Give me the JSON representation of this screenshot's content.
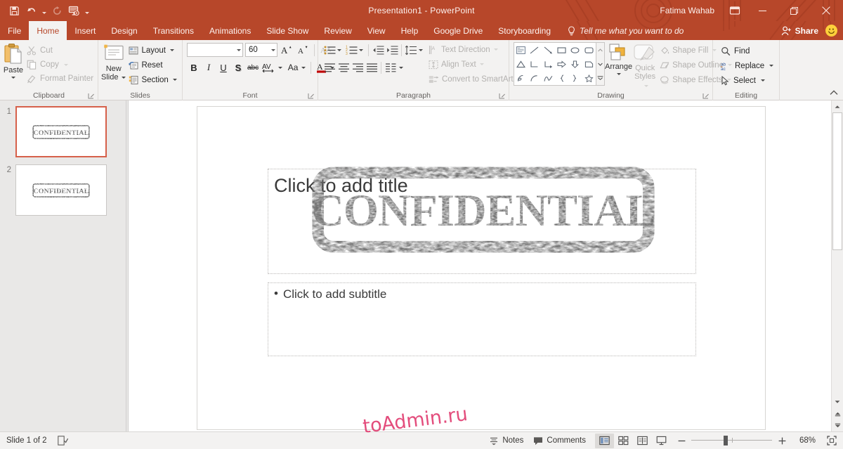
{
  "window": {
    "title": "Presentation1  -  PowerPoint",
    "account_name": "Fatima Wahab",
    "ribbon_display_icon": "ribbon-display-options-icon",
    "minimize_icon": "minimize-icon",
    "restore_icon": "restore-icon",
    "close_icon": "close-icon"
  },
  "quick_access": [
    {
      "name": "save",
      "icon": "save-icon"
    },
    {
      "name": "undo",
      "icon": "undo-icon"
    },
    {
      "name": "redo",
      "icon": "redo-icon"
    },
    {
      "name": "start-from-beginning",
      "icon": "slideshow-icon"
    },
    {
      "name": "customize-quick-access-toolbar",
      "icon": "chevron-down-icon"
    }
  ],
  "tabs": [
    {
      "label": "File",
      "active": false
    },
    {
      "label": "Home",
      "active": true
    },
    {
      "label": "Insert",
      "active": false
    },
    {
      "label": "Design",
      "active": false
    },
    {
      "label": "Transitions",
      "active": false
    },
    {
      "label": "Animations",
      "active": false
    },
    {
      "label": "Slide Show",
      "active": false
    },
    {
      "label": "Review",
      "active": false
    },
    {
      "label": "View",
      "active": false
    },
    {
      "label": "Help",
      "active": false
    },
    {
      "label": "Google Drive",
      "active": false
    },
    {
      "label": "Storyboarding",
      "active": false
    }
  ],
  "tell_me": {
    "label": "Tell me what you want to do",
    "icon": "lightbulb-icon"
  },
  "share": {
    "label": "Share",
    "icon": "share-person-icon"
  },
  "smiley": {
    "icon": "feedback-smiley-icon",
    "glyph": "☺"
  },
  "ribbon": {
    "clipboard": {
      "label": "Clipboard",
      "paste": "Paste",
      "items": [
        {
          "label": "Cut",
          "icon": "scissors-icon",
          "disabled": true
        },
        {
          "label": "Copy",
          "icon": "copy-icon",
          "disabled": true
        },
        {
          "label": "Format Painter",
          "icon": "format-painter-icon",
          "disabled": true
        }
      ]
    },
    "slides": {
      "label": "Slides",
      "new_slide_line1": "New",
      "new_slide_line2": "Slide",
      "items": [
        {
          "label": "Layout",
          "icon": "layout-icon"
        },
        {
          "label": "Reset",
          "icon": "reset-icon"
        },
        {
          "label": "Section",
          "icon": "section-icon"
        }
      ]
    },
    "font": {
      "label": "Font",
      "font_name_value": "",
      "font_name_placeholder": "",
      "font_size_value": "60",
      "buttons": [
        {
          "name": "clear-formatting",
          "label": "A"
        },
        {
          "name": "bold",
          "label": "B"
        },
        {
          "name": "italic",
          "label": "I"
        },
        {
          "name": "underline",
          "label": "U"
        },
        {
          "name": "text-shadow",
          "label": "S"
        },
        {
          "name": "strikethrough",
          "label": "abc"
        },
        {
          "name": "character-spacing",
          "label": "AV"
        },
        {
          "name": "change-case",
          "label": "Aa"
        },
        {
          "name": "font-color",
          "label": "A"
        },
        {
          "name": "increase-font-size",
          "label": "A"
        },
        {
          "name": "decrease-font-size",
          "label": "A"
        }
      ]
    },
    "paragraph": {
      "label": "Paragraph",
      "right_items": [
        {
          "label": "Text Direction",
          "icon": "text-direction-icon",
          "disabled": true
        },
        {
          "label": "Align Text",
          "icon": "align-text-icon",
          "disabled": true
        },
        {
          "label": "Convert to SmartArt",
          "icon": "smartart-icon",
          "disabled": true
        }
      ]
    },
    "drawing": {
      "label": "Drawing",
      "arrange": "Arrange",
      "quick_styles_line1": "Quick",
      "quick_styles_line2": "Styles",
      "shapes": [
        "textbox-shape",
        "line-shape",
        "arrow-line-shape",
        "rectangle-shape",
        "oval-shape",
        "rounded-rectangle-shape",
        "triangle-shape",
        "elbow-connector-shape",
        "elbow-arrow-shape",
        "right-arrow-shape",
        "down-arrow-shape",
        "flowchart-shape",
        "freeform-shape",
        "arc-shape",
        "curve-shape",
        "left-brace-shape",
        "right-brace-shape",
        "star-shape"
      ],
      "items": [
        {
          "label": "Shape Fill",
          "icon": "shape-fill-icon",
          "disabled": true
        },
        {
          "label": "Shape Outline",
          "icon": "shape-outline-icon",
          "disabled": true
        },
        {
          "label": "Shape Effects",
          "icon": "shape-effects-icon",
          "disabled": true
        }
      ]
    },
    "editing": {
      "label": "Editing",
      "items": [
        {
          "label": "Find",
          "icon": "search-icon",
          "caret": false
        },
        {
          "label": "Replace",
          "icon": "replace-icon",
          "caret": true
        },
        {
          "label": "Select",
          "icon": "select-cursor-icon",
          "caret": true
        }
      ]
    },
    "collapse_icon": "chevron-up-icon"
  },
  "thumbnails": [
    {
      "number": "1",
      "selected": true,
      "stamp_text": "CONFIDENTIAL"
    },
    {
      "number": "2",
      "selected": false,
      "stamp_text": "CONFIDENTIAL"
    }
  ],
  "slide": {
    "title_placeholder": "Click to add title",
    "subtitle_placeholder": "Click to add subtitle",
    "subtitle_bullet": "•",
    "watermark_text": "CONFIDENTIAL",
    "watermark_color": "#6e6e6e"
  },
  "scrollbar": {
    "up_icon": "scroll-up-icon",
    "down_icon": "scroll-down-icon",
    "previous_slide_icon": "previous-slide-icon",
    "next_slide_icon": "next-slide-icon"
  },
  "statusbar": {
    "slide_counter": "Slide 1 of 2",
    "accessibility_icon": "accessibility-checker-icon",
    "notes": {
      "label": "Notes",
      "icon": "notes-icon"
    },
    "comments": {
      "label": "Comments",
      "icon": "comments-icon"
    },
    "views": [
      {
        "name": "normal-view",
        "icon": "normal-view-icon",
        "active": true
      },
      {
        "name": "slide-sorter-view",
        "icon": "slide-sorter-icon",
        "active": false
      },
      {
        "name": "reading-view",
        "icon": "reading-view-icon",
        "active": false
      },
      {
        "name": "slide-show-view",
        "icon": "slide-show-icon",
        "active": false
      }
    ],
    "zoom": {
      "minus": "−",
      "plus": "+",
      "level": "68%"
    },
    "fit_slide_icon": "fit-to-window-icon"
  },
  "overlay_watermark": "toAdmin.ru",
  "colors": {
    "accent": "#b7472a",
    "ribbon_bg": "#f3f2f1",
    "selected_thumb_border": "#d6604a",
    "watermark_pink": "#e0356b"
  }
}
